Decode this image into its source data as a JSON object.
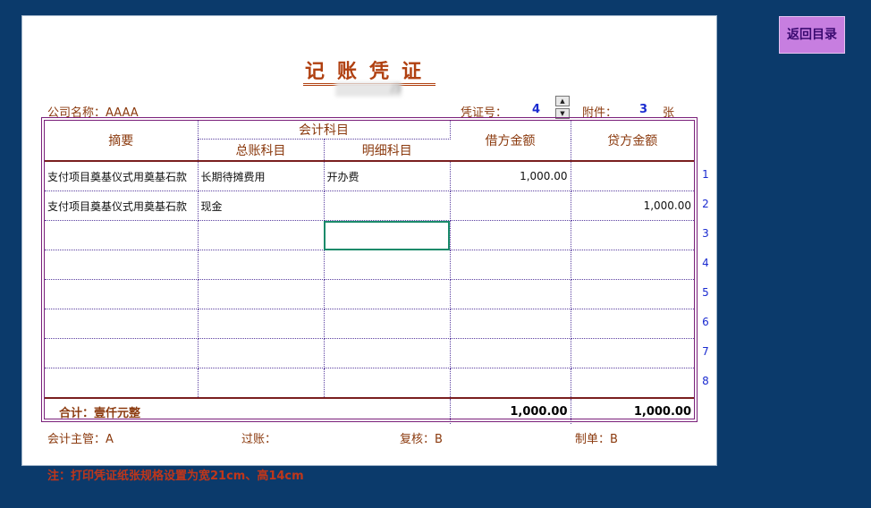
{
  "back_button": {
    "label": "返回目录"
  },
  "voucher": {
    "title": "记账凭证",
    "date_text": "/3",
    "company_label": "公司名称：",
    "company_name": "AAAA",
    "voucher_no_label": "凭证号：",
    "voucher_no": "4",
    "attachment_label": "附件：",
    "attachment_count": "3",
    "attachment_unit": "张"
  },
  "table": {
    "headers": {
      "summary": "摘要",
      "account_group": "会计科目",
      "general_account": "总账科目",
      "detail_account": "明细科目",
      "debit": "借方金额",
      "credit": "贷方金额"
    },
    "rows": [
      {
        "summary": "支付项目奠基仪式用奠基石款",
        "general": "长期待摊费用",
        "detail": "开办费",
        "debit": "1,000.00",
        "credit": ""
      },
      {
        "summary": "支付项目奠基仪式用奠基石款",
        "general": "现金",
        "detail": "",
        "debit": "",
        "credit": "1,000.00"
      },
      {
        "summary": "",
        "general": "",
        "detail": "",
        "debit": "",
        "credit": ""
      },
      {
        "summary": "",
        "general": "",
        "detail": "",
        "debit": "",
        "credit": ""
      },
      {
        "summary": "",
        "general": "",
        "detail": "",
        "debit": "",
        "credit": ""
      },
      {
        "summary": "",
        "general": "",
        "detail": "",
        "debit": "",
        "credit": ""
      },
      {
        "summary": "",
        "general": "",
        "detail": "",
        "debit": "",
        "credit": ""
      },
      {
        "summary": "",
        "general": "",
        "detail": "",
        "debit": "",
        "credit": ""
      }
    ],
    "row_numbers": [
      "1",
      "2",
      "3",
      "4",
      "5",
      "6",
      "7",
      "8"
    ],
    "total": {
      "label": "合计：壹仟元整",
      "debit": "1,000.00",
      "credit": "1,000.00"
    }
  },
  "signatures": {
    "supervisor": "会计主管：A",
    "posting": "过账：",
    "review": "复核：B",
    "prepared": "制单：B"
  },
  "note": "注：打印凭证纸张规格设置为宽21cm、高14cm",
  "colors": {
    "background": "#0b3a6b",
    "label": "#8b3a0e",
    "value": "#1a2bd0",
    "border": "#7a1f7a",
    "button": "#c77ee0"
  }
}
